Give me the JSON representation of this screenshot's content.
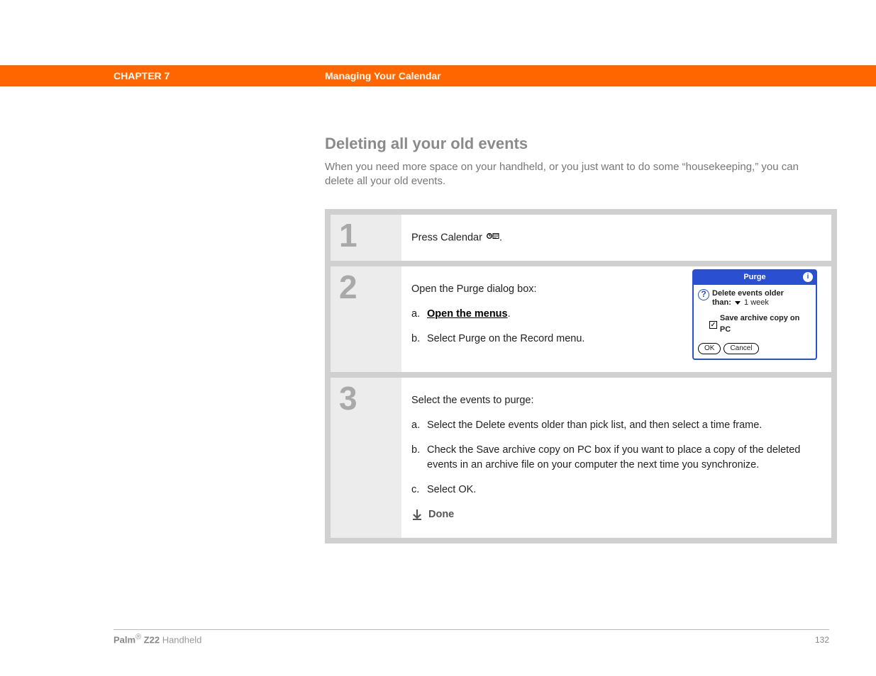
{
  "header": {
    "chapter": "CHAPTER 7",
    "section": "Managing Your Calendar"
  },
  "title": "Deleting all your old events",
  "intro": "When you need more space on your handheld, or you just want to do some “housekeeping,” you can delete all your old events.",
  "steps": [
    {
      "num": "1",
      "lead_pre": "Press Calendar ",
      "lead_post": "."
    },
    {
      "num": "2",
      "lead": "Open the Purge dialog box:",
      "subs": [
        {
          "letter": "a.",
          "link": "Open the menus",
          "suffix": "."
        },
        {
          "letter": "b.",
          "text": "Select Purge on the Record menu."
        }
      ]
    },
    {
      "num": "3",
      "lead": "Select the events to purge:",
      "subs": [
        {
          "letter": "a.",
          "text": "Select the Delete events older than pick list, and then select a time frame."
        },
        {
          "letter": "b.",
          "text": "Check the Save archive copy on PC box if you want to place a copy of the deleted events in an archive file on your computer the next time you synchronize."
        },
        {
          "letter": "c.",
          "text": "Select OK."
        }
      ],
      "done": "Done"
    }
  ],
  "dialog": {
    "title": "Purge",
    "info": "i",
    "question": "?",
    "line1": "Delete events older",
    "line2_label": "than:",
    "line2_value": "1 week",
    "checkbox_checked": "✓",
    "checkbox_label": "Save archive copy on PC",
    "ok": "OK",
    "cancel": "Cancel"
  },
  "footer": {
    "brand_bold": "Palm",
    "brand_reg": "®",
    "brand_model": " Z22 ",
    "brand_suffix": "Handheld",
    "page": "132"
  }
}
